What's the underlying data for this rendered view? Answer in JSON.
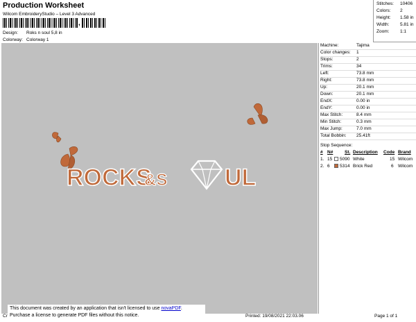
{
  "header": {
    "title": "Production Worksheet",
    "subtitle": "Wilcom EmbroideryStudio – Level 3 Advanced",
    "barcode_comma": ",",
    "design_label": "Design:",
    "design_value": "Roks n soul 5,8 in",
    "colorway_label": "Colorway:",
    "colorway_value": "Colorway 1"
  },
  "stats": [
    {
      "label": "Stitches:",
      "value": "10406"
    },
    {
      "label": "Colors:",
      "value": "2"
    },
    {
      "label": "Height:",
      "value": "1.58 in"
    },
    {
      "label": "Width:",
      "value": "5.81 in"
    },
    {
      "label": "Zoom:",
      "value": "1:1"
    }
  ],
  "details": [
    {
      "label": "Machine:",
      "value": "Tajima"
    },
    {
      "label": "Color changes:",
      "value": "1"
    },
    {
      "label": "Stops:",
      "value": "2"
    },
    {
      "label": "Trims:",
      "value": "34"
    },
    {
      "label": "Left:",
      "value": "73.8 mm"
    },
    {
      "label": "Right:",
      "value": "73.8 mm"
    },
    {
      "label": "Up:",
      "value": "20.1 mm"
    },
    {
      "label": "Down:",
      "value": "20.1 mm"
    },
    {
      "label": "EndX:",
      "value": "0.00 in"
    },
    {
      "label": "EndY:",
      "value": "0.00 in"
    },
    {
      "label": "Max Stitch:",
      "value": "8.4 mm"
    },
    {
      "label": "Min Stitch:",
      "value": "0.3 mm"
    },
    {
      "label": "Max Jump:",
      "value": "7.0 mm"
    },
    {
      "label": "Total Bobbin:",
      "value": "25.41ft"
    }
  ],
  "stop_sequence": {
    "title": "Stop Sequence:",
    "headers": [
      "#",
      "N#",
      "St.",
      "Description",
      "Code",
      "Brand"
    ],
    "rows": [
      {
        "num": "1.",
        "n": "15",
        "color": "#ffffff",
        "code_id": "5090",
        "description": "White",
        "code": "15",
        "brand": "Wilcom"
      },
      {
        "num": "2.",
        "n": "6",
        "color": "#c0693a",
        "code_id": "5314",
        "description": "Brick Red",
        "code": "6",
        "brand": "Wilcom"
      }
    ]
  },
  "design": {
    "text_left": "ROCKS",
    "text_amp": "&S",
    "text_right": "UL",
    "fill_color": "#c0693a",
    "outline_color": "#ffffff"
  },
  "notice": {
    "line1_prefix": "This document was created by an application that isn't licensed to use ",
    "link": "novaPDF",
    "line1_suffix": ".",
    "line2": "Purchase a license to generate PDF files without this notice."
  },
  "footer": {
    "left": "Cr",
    "printed": "Printed: 19/08/2021 22:03.06",
    "page": "Page 1 of 1"
  }
}
